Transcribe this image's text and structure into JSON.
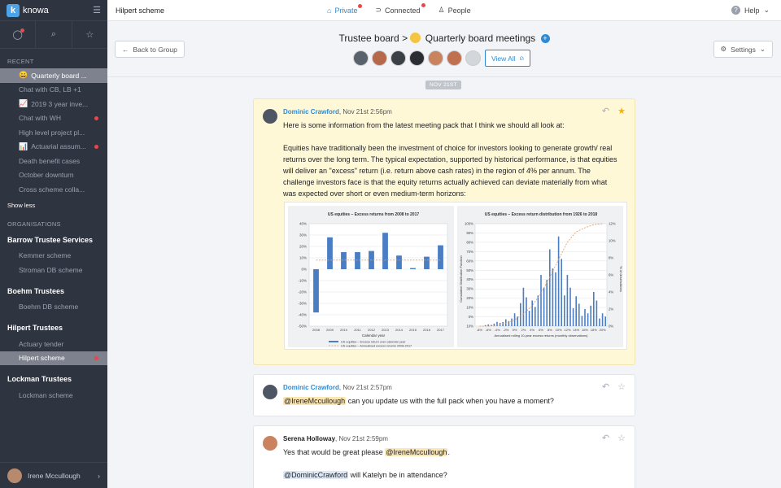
{
  "app": {
    "logo_text": "knowa",
    "menu_icon": "hamburger-icon"
  },
  "sidebar": {
    "top_icons": [
      "chat-icon",
      "search-icon",
      "star-icon"
    ],
    "recent_label": "RECENT",
    "recent_items": [
      {
        "label": "Quarterly board ...",
        "icon": "😀",
        "active": true,
        "unread": false
      },
      {
        "label": "Chat with CB, LB +1",
        "icon": "",
        "active": false,
        "unread": false
      },
      {
        "label": "2019 3 year inve...",
        "icon": "📈",
        "active": false,
        "unread": false
      },
      {
        "label": "Chat with WH",
        "icon": "",
        "active": false,
        "unread": true
      },
      {
        "label": "High level project pl...",
        "icon": "",
        "active": false,
        "unread": false
      },
      {
        "label": "Actuarial assum...",
        "icon": "📊",
        "active": false,
        "unread": true
      },
      {
        "label": "Death benefit cases",
        "icon": "",
        "active": false,
        "unread": false
      },
      {
        "label": "October downturn",
        "icon": "",
        "active": false,
        "unread": false
      },
      {
        "label": "Cross scheme colla...",
        "icon": "",
        "active": false,
        "unread": false
      }
    ],
    "show_less": "Show less",
    "organisations_label": "ORGANISATIONS",
    "orgs": [
      {
        "name": "Barrow Trustee Services",
        "schemes": [
          {
            "label": "Kemmer scheme",
            "active": false,
            "unread": false
          },
          {
            "label": "Stroman DB scheme",
            "active": false,
            "unread": false
          }
        ]
      },
      {
        "name": "Boehm Trustees",
        "schemes": [
          {
            "label": "Boehm DB scheme",
            "active": false,
            "unread": false
          }
        ]
      },
      {
        "name": "Hilpert Trustees",
        "schemes": [
          {
            "label": "Actuary tender",
            "active": false,
            "unread": false
          },
          {
            "label": "Hilpert scheme",
            "active": true,
            "unread": true
          }
        ]
      },
      {
        "name": "Lockman Trustees",
        "schemes": [
          {
            "label": "Lockman scheme",
            "active": false,
            "unread": false
          }
        ]
      }
    ],
    "user": {
      "name": "Irene Mccullough",
      "arrow": "›"
    }
  },
  "topbar": {
    "title": "Hilpert scheme",
    "tabs": [
      {
        "label": "Private",
        "icon": "lock-icon",
        "selected": true,
        "dot": true
      },
      {
        "label": "Connected",
        "icon": "link-icon",
        "selected": false,
        "dot": true
      },
      {
        "label": "People",
        "icon": "person-icon",
        "selected": false,
        "dot": false
      }
    ],
    "help": "Help"
  },
  "header": {
    "back": "Back to Group",
    "breadcrumb_parent": "Trustee board",
    "separator": ">",
    "title": "Quarterly board meetings",
    "view_all": "View All",
    "settings": "Settings",
    "member_colors": [
      "#59616d",
      "#b5694a",
      "#3b3f46",
      "#2a2d33",
      "#c9845f",
      "#c0704f",
      "#d3d6db"
    ]
  },
  "feed": {
    "date": "NOV 21ST",
    "messages": [
      {
        "author": "Dominic Crawford",
        "time": "Nov 21st 2:56pm",
        "starred": true,
        "highlight": true,
        "p1": "Here is some information from the latest meeting pack that I think we should all look at:",
        "p2": "Equities have traditionally been the investment of choice for investors looking to generate growth/ real returns over the long term. The typical expectation, supported by historical performance, is that equities will deliver an \"excess\" return (i.e. return above cash rates) in the region of 4% per annum. The challenge investors face is that the equity returns actually achieved can deviate materially from what was expected over short or even medium-term horizons:"
      },
      {
        "author": "Dominic Crawford",
        "time": "Nov 21st 2:57pm",
        "starred": false,
        "mention": "@IreneMccullough",
        "text": " can you update us with the full pack when you have a moment?"
      },
      {
        "author": "Serena Holloway",
        "time": "Nov 21st 2:59pm",
        "starred": false,
        "line1_pre": "Yes that would be great please ",
        "mention1": "@IreneMccullough",
        "line1_post": ".",
        "mention2": "@DominicCrawford",
        "line2_post": " will Katelyn be in attendance?"
      }
    ]
  },
  "chart_data": [
    {
      "type": "bar",
      "title": "US equities – Excess returns from 2008 to 2017",
      "categories": [
        "2008",
        "2009",
        "2010",
        "2011",
        "2012",
        "2013",
        "2014",
        "2015",
        "2016",
        "2017"
      ],
      "series": [
        {
          "name": "US equities – Excess return over calendar year",
          "values": [
            -38,
            28,
            15,
            15,
            16,
            32,
            12,
            1,
            11,
            21
          ]
        },
        {
          "name": "US equities – Annualised excess returns 2008-2017",
          "values": [
            8,
            8,
            8,
            8,
            8,
            8,
            8,
            8,
            8,
            8
          ]
        }
      ],
      "xlabel": "Calendar year",
      "ylabel": "",
      "ylim": [
        -50,
        40
      ],
      "yticks": [
        "40%",
        "30%",
        "20%",
        "10%",
        "0%",
        "-10%",
        "-20%",
        "-30%",
        "-40%",
        "-50%"
      ],
      "colors": [
        "#4a7ec4",
        "#e8965a"
      ],
      "legend": "bottom",
      "grid": true
    },
    {
      "type": "bar",
      "title": "US equities – Excess return distribution from 1926 to 2018",
      "categories": [
        "-8%",
        "-6%",
        "-4%",
        "-2%",
        "0%",
        "2%",
        "4%",
        "6%",
        "8%",
        "10%",
        "12%",
        "14%",
        "16%",
        "18%",
        "20%"
      ],
      "series": [
        {
          "name": "% of observations",
          "values": [
            0,
            0.2,
            0.5,
            0.8,
            1.5,
            4.5,
            3,
            6,
            9,
            10.5,
            6,
            3.5,
            2,
            4,
            1.5
          ]
        },
        {
          "name": "Cumulative distribution function",
          "values": [
            0,
            0,
            1,
            3,
            6,
            12,
            20,
            32,
            48,
            65,
            82,
            92,
            96,
            99,
            100
          ]
        }
      ],
      "xlabel": "Annualised rolling 10-year excess returns (monthly observations)",
      "ylabel": "Cumulative Distribution Function",
      "y2label": "% of observations",
      "ylim": [
        0,
        100
      ],
      "y2lim": [
        0,
        12
      ],
      "yticks": [
        "100%",
        "90%",
        "80%",
        "70%",
        "60%",
        "50%",
        "40%",
        "30%",
        "20%",
        "10%",
        "0%",
        "10%"
      ],
      "y2ticks": [
        "12%",
        "10%",
        "8%",
        "6%",
        "4%",
        "2%",
        "0%"
      ],
      "colors": [
        "#4a7ec4",
        "#e8965a"
      ],
      "legend": "none",
      "grid": true
    }
  ]
}
